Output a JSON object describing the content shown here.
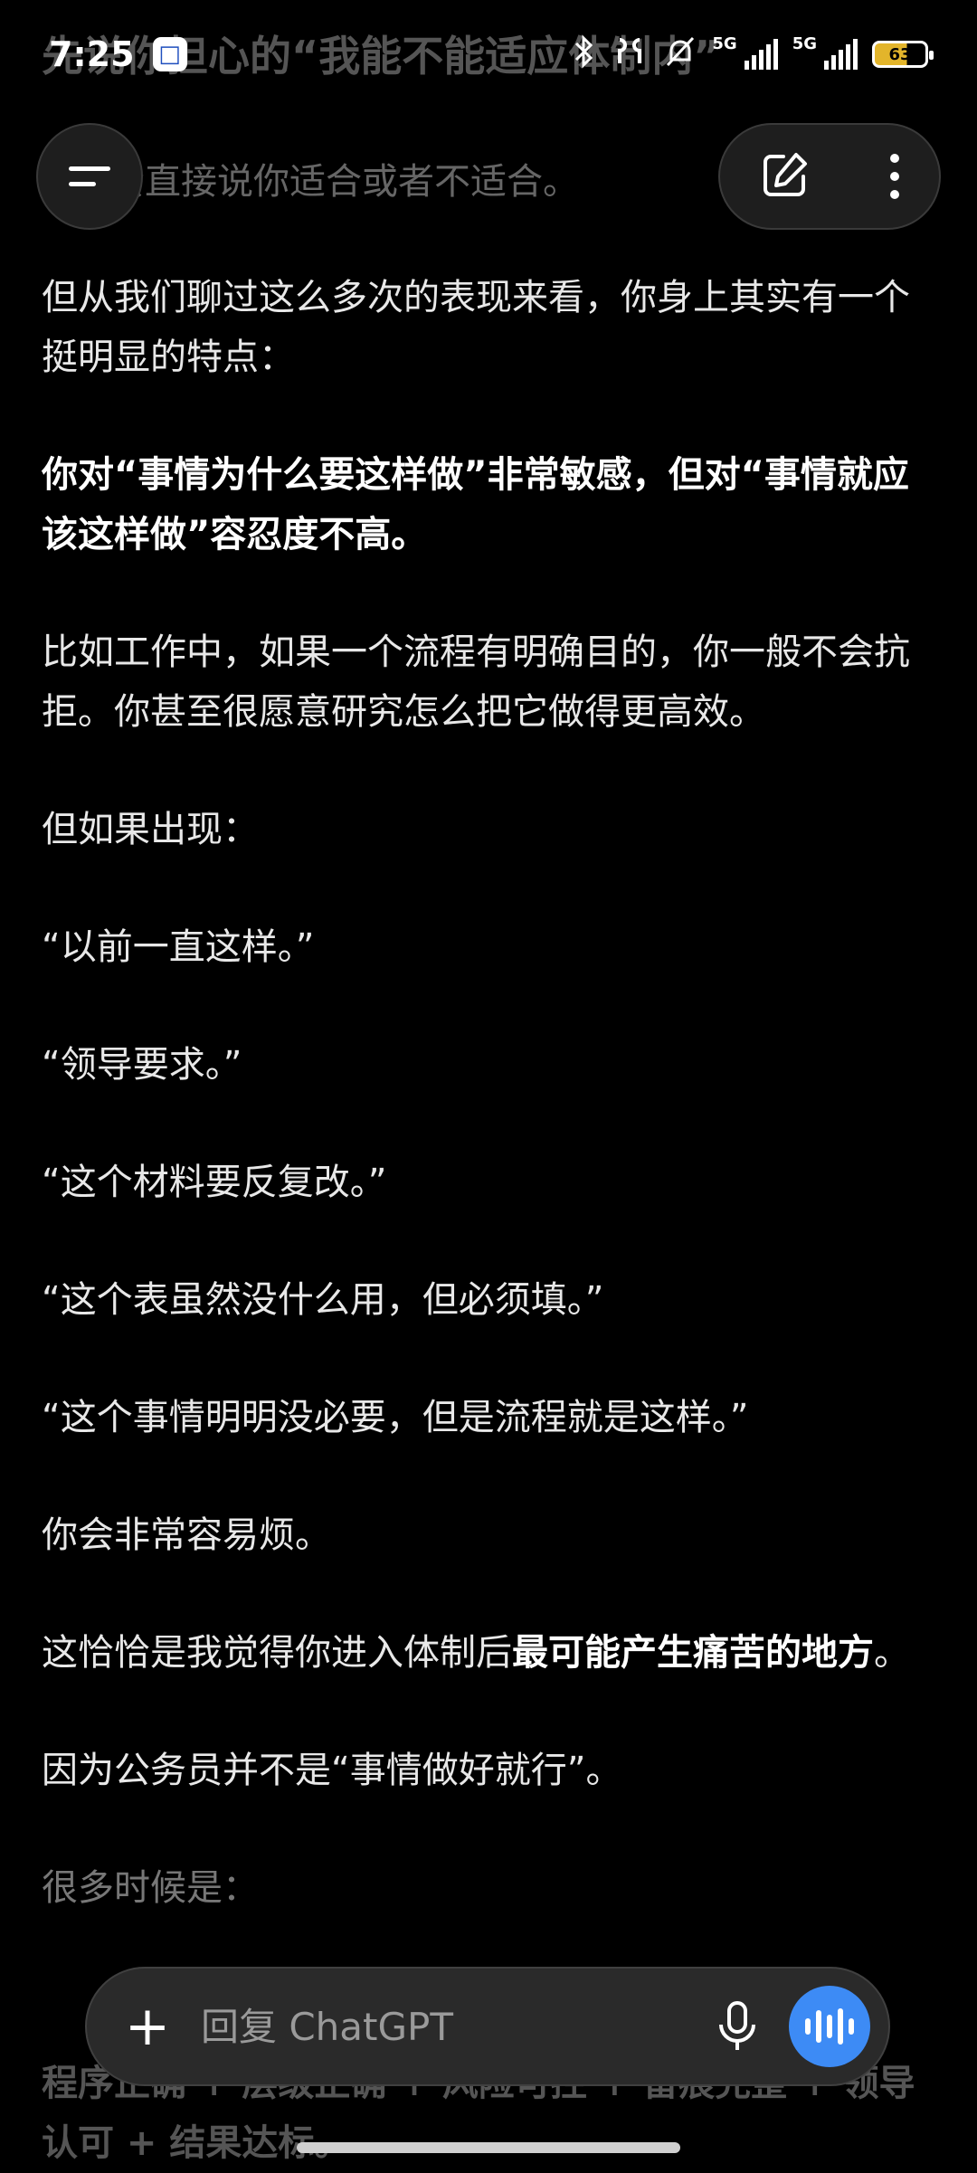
{
  "status": {
    "time": "7:25",
    "network1": "5G",
    "network2": "5G",
    "battery": "63"
  },
  "faded_header": "先说你担心的“我能不能适应体制内”",
  "faded_line": "会直接说你适合或者不适合。",
  "paragraphs": [
    {
      "text": "但从我们聊过这么多次的表现来看，你身上其实有一个挺明显的特点：",
      "bold": false
    },
    {
      "text": "你对“事情为什么要这样做”非常敏感，但对“事情就应该这样做”容忍度不高。",
      "bold": true
    },
    {
      "text": "比如工作中，如果一个流程有明确目的，你一般不会抗拒。你甚至很愿意研究怎么把它做得更高效。",
      "bold": false
    },
    {
      "text": "但如果出现：",
      "bold": false
    },
    {
      "text": "“以前一直这样。”",
      "bold": false
    },
    {
      "text": "“领导要求。”",
      "bold": false
    },
    {
      "text": "“这个材料要反复改。”",
      "bold": false
    },
    {
      "text": "“这个表虽然没什么用，但必须填。”",
      "bold": false
    },
    {
      "text": "“这个事情明明没必要，但是流程就是这样。”",
      "bold": false
    },
    {
      "text": "你会非常容易烦。",
      "bold": false
    }
  ],
  "mixed_paragraph": {
    "prefix": "这恰恰是我觉得你进入体制后",
    "bold": "最可能产生痛苦的地方",
    "suffix": "。"
  },
  "after_paragraph": "因为公务员并不是“事情做好就行”。",
  "dim_paragraph": "很多时候是：",
  "bottom_text": "程序正确 + 层级正确 + 风险可控 + 留痕完整 + 领导认可 + 结果达标。",
  "composer": {
    "placeholder": "回复 ChatGPT"
  },
  "icons": {
    "menu": "hamburger-icon",
    "edit": "edit-icon",
    "more": "more-vertical-icon",
    "plus": "plus-icon",
    "mic": "microphone-icon",
    "voice": "voice-mode-icon"
  },
  "colors": {
    "background": "#000000",
    "accent": "#3d8bf5",
    "battery": "#e3b52b"
  }
}
